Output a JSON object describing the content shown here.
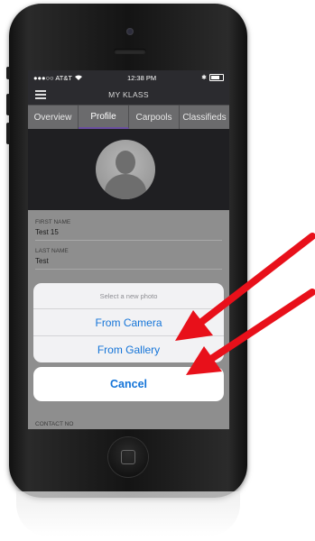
{
  "status_bar": {
    "carrier": "●●●○○ AT&T",
    "time": "12:38 PM"
  },
  "nav": {
    "title": "MY KLASS"
  },
  "tabs": [
    {
      "label": "Overview",
      "active": false
    },
    {
      "label": "Profile",
      "active": true
    },
    {
      "label": "Carpools",
      "active": false
    },
    {
      "label": "Classifieds",
      "active": false
    }
  ],
  "form": {
    "first_name_label": "FIRST NAME",
    "first_name_value": "Test 15",
    "last_name_label": "LAST NAME",
    "last_name_value": "Test",
    "contact_label": "CONTACT NO"
  },
  "action_sheet": {
    "title": "Select a new photo",
    "options": [
      "From Camera",
      "From Gallery"
    ],
    "cancel": "Cancel"
  },
  "colors": {
    "accent": "#1474d8",
    "tab_underline": "#6a4ea0",
    "arrow": "#e8101a"
  }
}
